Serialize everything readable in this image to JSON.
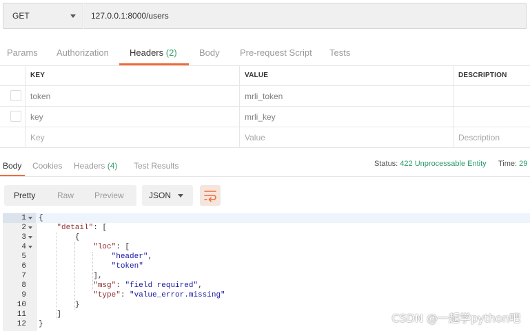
{
  "request": {
    "method": "GET",
    "url": "127.0.0.1:8000/users"
  },
  "request_tabs": [
    {
      "label": "Params"
    },
    {
      "label": "Authorization"
    },
    {
      "label": "Headers",
      "count": "(2)",
      "active": true
    },
    {
      "label": "Body"
    },
    {
      "label": "Pre-request Script"
    },
    {
      "label": "Tests"
    }
  ],
  "headers_table": {
    "columns": [
      "KEY",
      "VALUE",
      "DESCRIPTION"
    ],
    "rows": [
      {
        "key": "token",
        "value": "mrli_token",
        "description": ""
      },
      {
        "key": "key",
        "value": "mrli_key",
        "description": ""
      }
    ],
    "placeholder": {
      "key": "Key",
      "value": "Value",
      "description": "Description"
    }
  },
  "response_tabs": [
    {
      "label": "Body",
      "active": true
    },
    {
      "label": "Cookies"
    },
    {
      "label": "Headers",
      "count": "(4)"
    },
    {
      "label": "Test Results"
    }
  ],
  "response_status": {
    "status_label": "Status:",
    "status_value": "422 Unprocessable Entity",
    "time_label": "Time:",
    "time_value": "29"
  },
  "view_modes": [
    "Pretty",
    "Raw",
    "Preview"
  ],
  "active_view": "Pretty",
  "format": "JSON",
  "code_lines": [
    "{",
    "    \"detail\": [",
    "        {",
    "            \"loc\": [",
    "                \"header\",",
    "                \"token\"",
    "            ],",
    "            \"msg\": \"field required\",",
    "            \"type\": \"value_error.missing\"",
    "        }",
    "    ]",
    "}"
  ],
  "foldable_lines": [
    1,
    2,
    3,
    4
  ],
  "watermark": "CSDN @一起学python吧",
  "colors": {
    "accent": "#f26b3a",
    "count_green": "#3c9d6b",
    "status_green": "#2a9a6a",
    "json_key": "#912e2e",
    "json_string": "#1a1aa6"
  }
}
